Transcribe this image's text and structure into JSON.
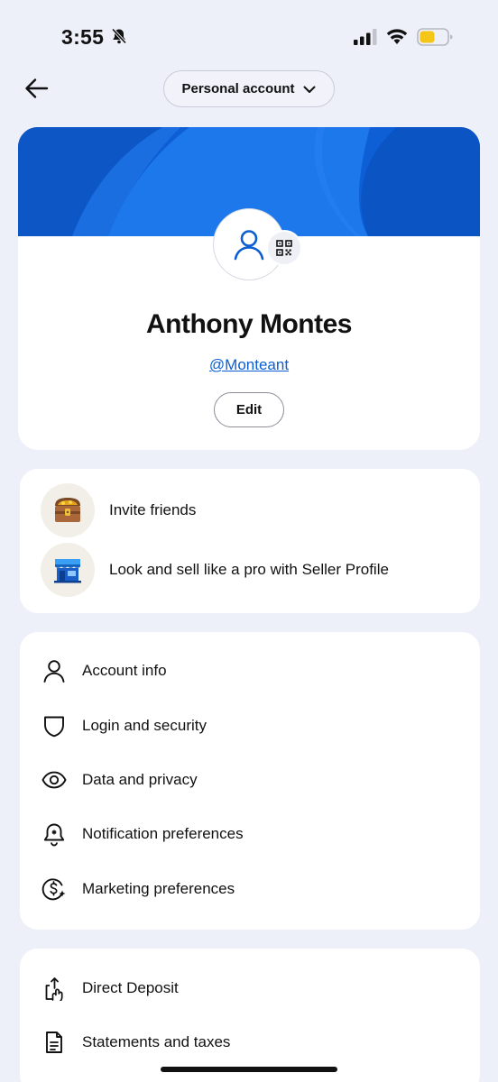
{
  "status_bar": {
    "time": "3:55",
    "battery_level": 0.55,
    "battery_color": "#f5c518"
  },
  "header": {
    "back_icon": "arrow-left-icon",
    "account_switch_label": "Personal account",
    "account_switch_icon": "chevron-down-icon"
  },
  "profile": {
    "banner_color": "#0b5fd3",
    "name": "Anthony Montes",
    "handle": "@Monteant",
    "edit_label": "Edit",
    "avatar_icon": "person-icon",
    "qr_icon": "qr-code-icon"
  },
  "promos": [
    {
      "label": "Invite friends",
      "icon": "treasure-chest-icon"
    },
    {
      "label": "Look and sell like a pro with Seller Profile",
      "icon": "storefront-icon"
    }
  ],
  "settings": [
    {
      "label": "Account info",
      "icon": "person-icon"
    },
    {
      "label": "Login and security",
      "icon": "shield-icon"
    },
    {
      "label": "Data and privacy",
      "icon": "eye-icon"
    },
    {
      "label": "Notification preferences",
      "icon": "bell-icon"
    },
    {
      "label": "Marketing preferences",
      "icon": "dollar-sparkle-icon"
    }
  ],
  "finance": [
    {
      "label": "Direct Deposit",
      "icon": "deposit-icon"
    },
    {
      "label": "Statements and taxes",
      "icon": "document-icon"
    }
  ],
  "colors": {
    "background": "#eef0f9",
    "accent": "#0b5fd3"
  }
}
